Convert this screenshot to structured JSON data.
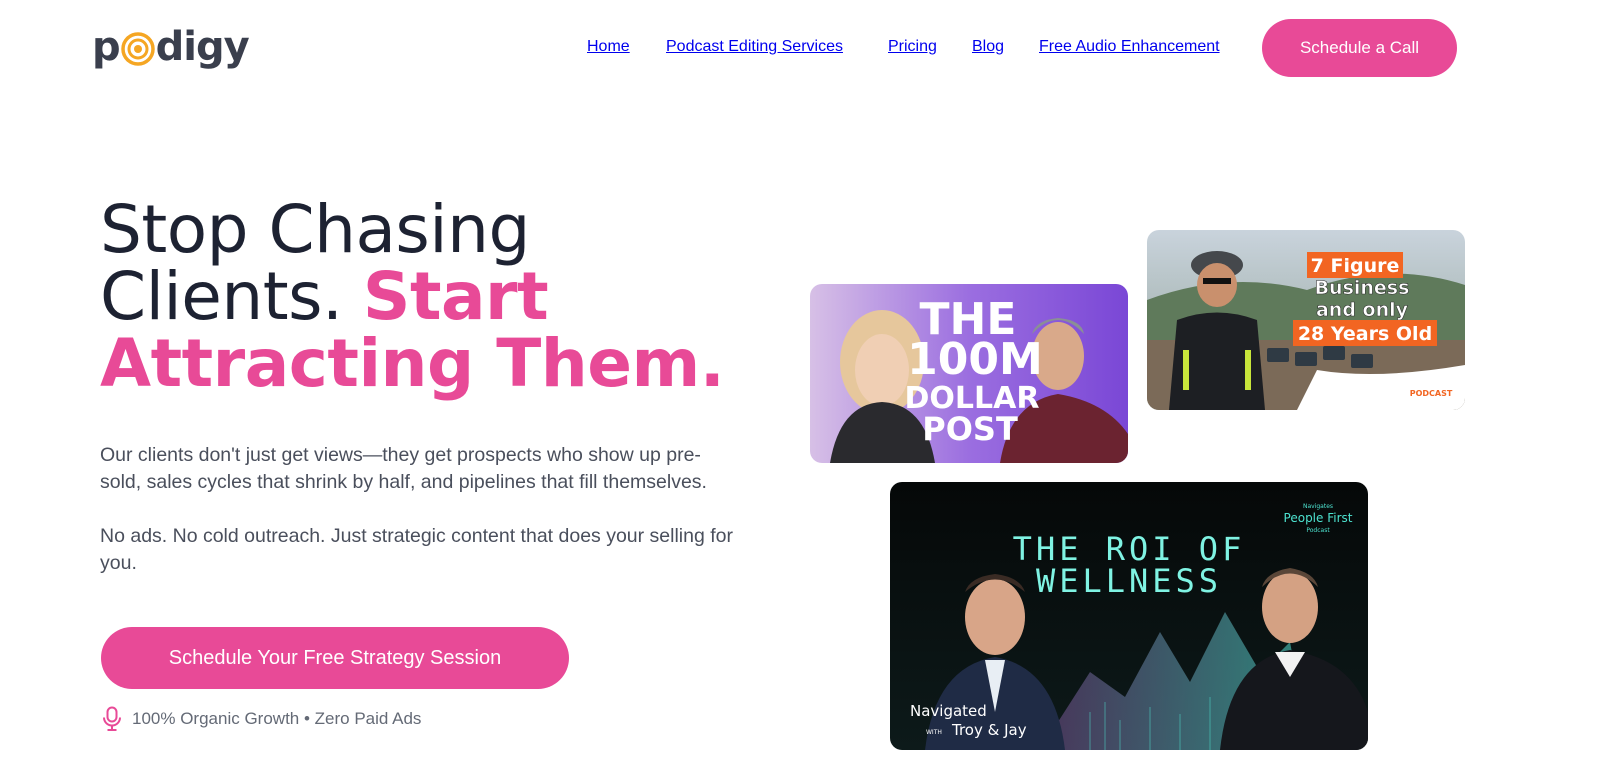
{
  "header": {
    "logo_text_before": "p",
    "logo_text_after": "digy",
    "nav": [
      {
        "label": "Home"
      },
      {
        "label": "Podcast Editing Services"
      },
      {
        "label": "Pricing"
      },
      {
        "label": "Blog"
      },
      {
        "label": "Free Audio Enhancement"
      }
    ],
    "cta_label": "Schedule a Call"
  },
  "hero": {
    "headline_line1": "Stop Chasing",
    "headline_line2_plain": "Clients. ",
    "headline_line2_accent": "Start",
    "headline_line3_accent": "Attracting Them.",
    "paragraph1": "Our clients don't just get views—they get prospects who show up pre-sold, sales cycles that shrink by half, and pipelines that fill themselves.",
    "paragraph2": "No ads. No cold outreach. Just strategic content that does your selling for you.",
    "cta_label": "Schedule Your Free Strategy Session",
    "badge_text": "100% Organic Growth • Zero Paid Ads"
  },
  "thumbnails": {
    "thumb1": {
      "line1": "THE",
      "line2": "100M",
      "line3": "DOLLAR",
      "line4": "POST"
    },
    "thumb2": {
      "line1": "7 Figure",
      "line2": "Business",
      "line3": "and only",
      "line4": "28 Years Old",
      "show_name": "PODCAST"
    },
    "thumb3": {
      "line1": "THE ROI OF",
      "line2": "WELLNESS",
      "brand_small": "Navigates",
      "brand_main": "People First",
      "brand_sub": "Podcast",
      "host_title": "Navigated",
      "host_with": "WITH",
      "host_names": "Troy & Jay"
    }
  },
  "colors": {
    "accent": "#e84a97",
    "heading": "#1d2232",
    "body_text": "#4a4f5c",
    "logo_orange": "#f5a623",
    "thumb3_teal": "#4de3d0"
  },
  "icons": {
    "badge_icon": "microphone-icon",
    "logo_mark": "sound-wave-icon"
  }
}
